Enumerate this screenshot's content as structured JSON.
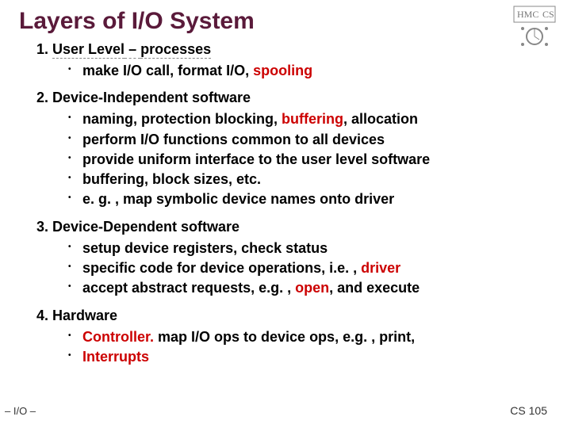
{
  "title": "Layers of I/O System",
  "items": [
    {
      "heading_plain": "User Level – processes",
      "heading_pre": "User Level",
      "heading_dash": " – ",
      "heading_post": "processes",
      "dashed": true,
      "bullets": [
        {
          "pre": "make I/O call, format I/O, ",
          "em": "spooling",
          "post": ""
        }
      ]
    },
    {
      "heading_plain": "Device-Independent software",
      "bullets": [
        {
          "pre": "naming, protection blocking, ",
          "em": "buffering",
          "post": ", allocation"
        },
        {
          "pre": "perform I/O functions common to all devices",
          "em": "",
          "post": ""
        },
        {
          "pre": "provide uniform interface to the user level software",
          "em": "",
          "post": ""
        },
        {
          "pre": "buffering, block sizes, etc.",
          "em": "",
          "post": ""
        },
        {
          "pre": "e. g. , map symbolic device names onto driver",
          "em": "",
          "post": ""
        }
      ]
    },
    {
      "heading_plain": "Device-Dependent software",
      "bullets": [
        {
          "pre": "setup device registers, check status",
          "em": "",
          "post": ""
        },
        {
          "pre": "specific code for device operations, i.e. , ",
          "em": "driver",
          "post": ""
        },
        {
          "pre": "accept abstract requests, e.g. , ",
          "em": "open",
          "post": ", and execute"
        }
      ]
    },
    {
      "heading_plain": "Hardware",
      "bullets": [
        {
          "pre": "",
          "em": "Controller.",
          "post": " map I/O ops to device ops, e.g. , print,"
        },
        {
          "pre": "",
          "em": "Interrupts",
          "post": ""
        }
      ]
    }
  ],
  "footer_left": "– I/O –",
  "footer_right": "CS 105"
}
